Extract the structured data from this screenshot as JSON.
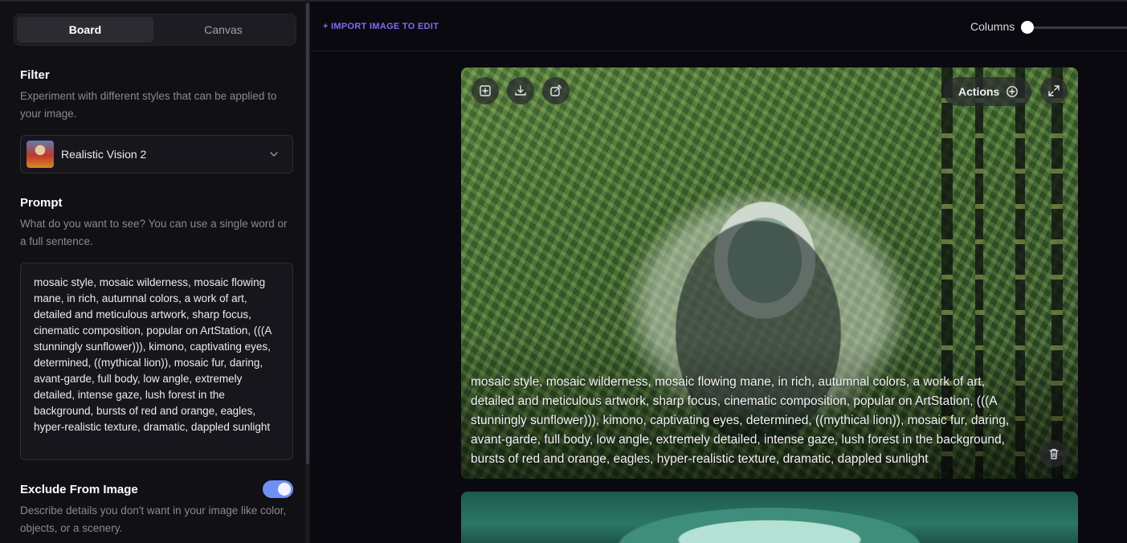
{
  "sidebar": {
    "tabs": [
      {
        "label": "Board",
        "active": true
      },
      {
        "label": "Canvas",
        "active": false
      }
    ],
    "filter": {
      "title": "Filter",
      "description": "Experiment with different styles that can be applied to your image.",
      "selected_style": "Realistic Vision 2"
    },
    "prompt": {
      "title": "Prompt",
      "description": "What do you want to see? You can use a single word or a full sentence.",
      "value": "mosaic style, mosaic wilderness, mosaic flowing mane, in rich, autumnal colors, a work of art, detailed and meticulous artwork, sharp focus, cinematic composition, popular on ArtStation, (((A stunningly sunflower))), kimono, captivating eyes, determined, ((mythical lion)), mosaic fur, daring, avant-garde, full body, low angle, extremely detailed, intense gaze, lush forest in the background, bursts of red and orange, eagles, hyper-realistic texture, dramatic, dappled sunlight"
    },
    "exclude": {
      "title": "Exclude From Image",
      "enabled": true,
      "description": "Describe details you don't want in your image like color, objects, or a scenery."
    }
  },
  "topbar": {
    "import_label": "+ IMPORT IMAGE TO EDIT",
    "columns_label": "Columns",
    "columns_value": 0
  },
  "gallery": {
    "cards": [
      {
        "actions_label": "Actions",
        "caption": "mosaic style, mosaic wilderness, mosaic flowing mane, in rich, autumnal colors, a work of art, detailed and meticulous artwork, sharp focus, cinematic composition, popular on ArtStation, (((A stunningly sunflower))), kimono, captivating eyes, determined, ((mythical lion)), mosaic fur, daring, avant-garde, full body, low angle, extremely detailed, intense gaze, lush forest in the background, bursts of red and orange, eagles, hyper-realistic texture, dramatic, dappled sunlight"
      }
    ]
  },
  "icons": {
    "card_top_left": [
      "add-to-canvas-icon",
      "download-icon",
      "edit-image-icon"
    ],
    "actions": "plus-circle-icon",
    "expand": "expand-icon",
    "delete": "trash-icon",
    "dropdown": "chevron-down-icon"
  },
  "colors": {
    "accent": "#7f6cf2",
    "toggle_on": "#6f8ff5",
    "background": "#0b0910",
    "sidebar": "#111015"
  }
}
